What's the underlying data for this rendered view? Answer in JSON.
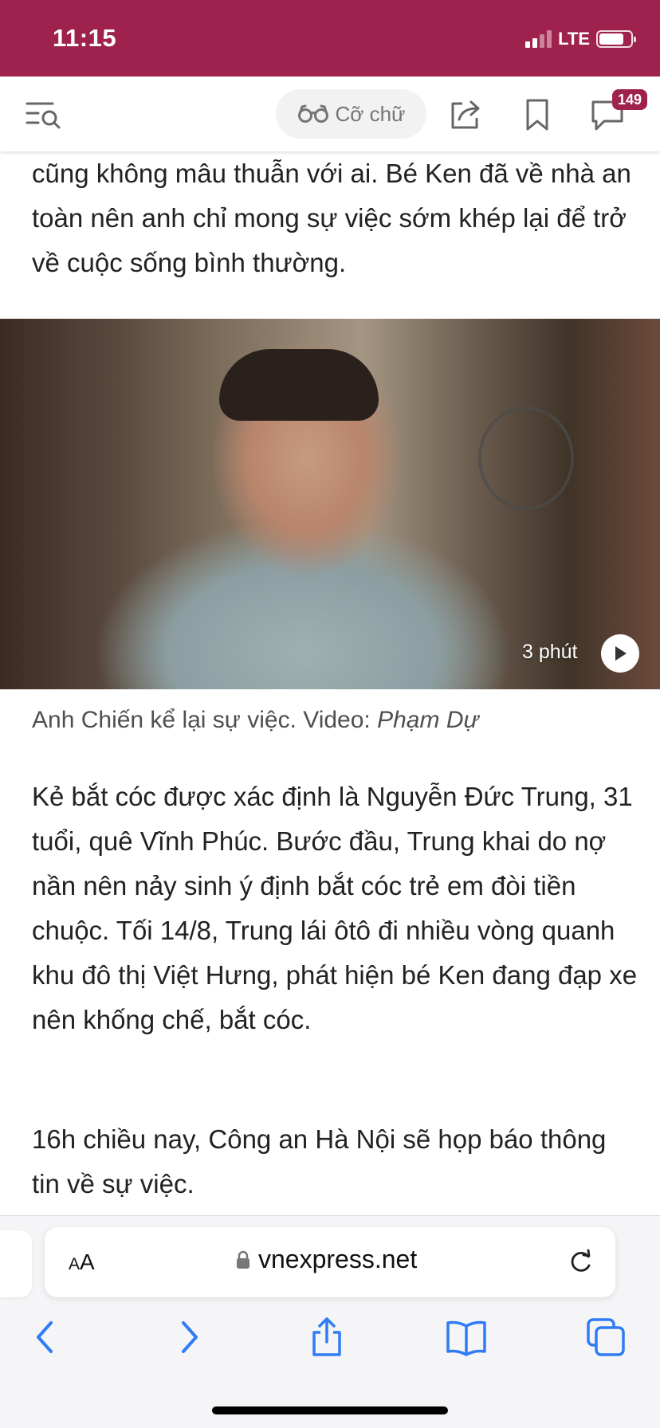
{
  "status_bar": {
    "time": "11:15",
    "network": "LTE"
  },
  "toolbar": {
    "font_size_label": "Cỡ chữ",
    "comment_count": "149"
  },
  "article": {
    "para_1": "cũng không mâu thuẫn với ai. Bé Ken đã về nhà an toàn nên anh chỉ mong sự việc sớm khép lại để trở về cuộc sống bình thường.",
    "video": {
      "duration": "3 phút"
    },
    "caption": {
      "text": "Anh Chiến kể lại sự việc. Video: ",
      "author": "Phạm Dự"
    },
    "para_2": "Kẻ bắt cóc được xác định là Nguyễn Đức Trung, 31 tuổi, quê Vĩnh Phúc. Bước đầu, Trung khai do nợ nần nên nảy sinh ý định bắt cóc trẻ em đòi tiền chuộc. Tối 14/8, Trung lái ôtô đi nhiều vòng quanh khu đô thị Việt Hưng, phát hiện bé Ken đang đạp xe nên khống chế, bắt cóc.",
    "para_3": "16h chiều nay, Công an Hà Nội sẽ họp báo thông tin về sự việc."
  },
  "browser": {
    "aa_label_small": "A",
    "aa_label_large": "A",
    "url": "vnexpress.net"
  },
  "colors": {
    "brand": "#9f224e",
    "accent_ios": "#2f7cf6"
  },
  "icons": [
    "menu-search-icon",
    "glasses-icon",
    "share-icon",
    "bookmark-icon",
    "comment-icon",
    "play-icon",
    "lock-icon",
    "reload-icon",
    "back-icon",
    "forward-icon",
    "share-sheet-icon",
    "bookmarks-icon",
    "tabs-icon"
  ]
}
